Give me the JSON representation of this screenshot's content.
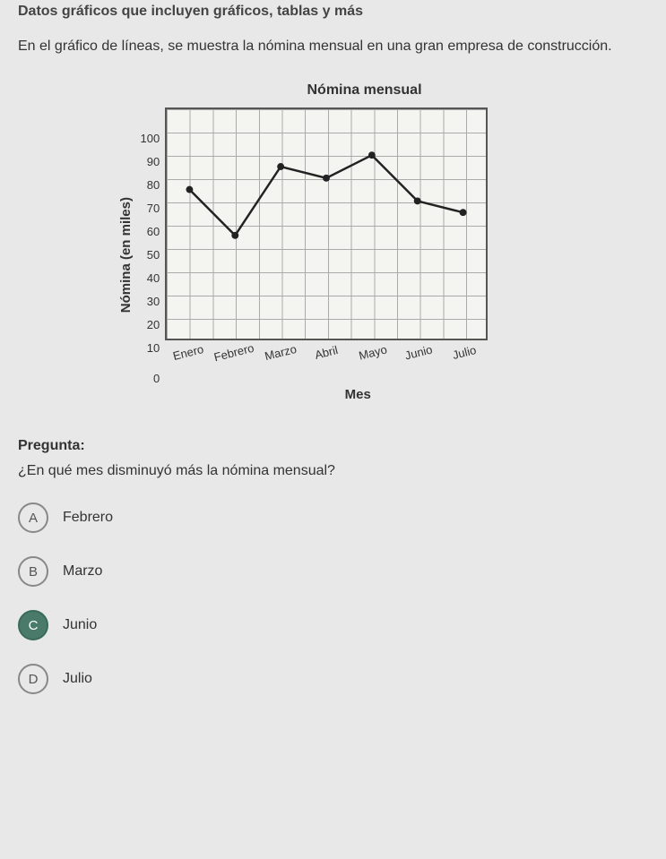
{
  "header": "Datos gráficos que incluyen gráficos, tablas y más",
  "intro": "En el gráfico de líneas, se muestra la nómina mensual en una gran empresa de construcción.",
  "chart_data": {
    "type": "line",
    "title": "Nómina mensual",
    "xlabel": "Mes",
    "ylabel": "Nómina (en miles)",
    "ylim": [
      0,
      100
    ],
    "yticks": [
      100,
      90,
      80,
      70,
      60,
      50,
      40,
      30,
      20,
      10,
      0
    ],
    "categories": [
      "Enero",
      "Febrero",
      "Marzo",
      "Abril",
      "Mayo",
      "Junio",
      "Julio"
    ],
    "values": [
      65,
      45,
      75,
      70,
      80,
      60,
      55
    ]
  },
  "question": {
    "label": "Pregunta:",
    "text": "¿En qué mes disminuyó más la nómina mensual?",
    "options": [
      {
        "letter": "A",
        "text": "Febrero",
        "selected": false
      },
      {
        "letter": "B",
        "text": "Marzo",
        "selected": false
      },
      {
        "letter": "C",
        "text": "Junio",
        "selected": true
      },
      {
        "letter": "D",
        "text": "Julio",
        "selected": false
      }
    ]
  }
}
